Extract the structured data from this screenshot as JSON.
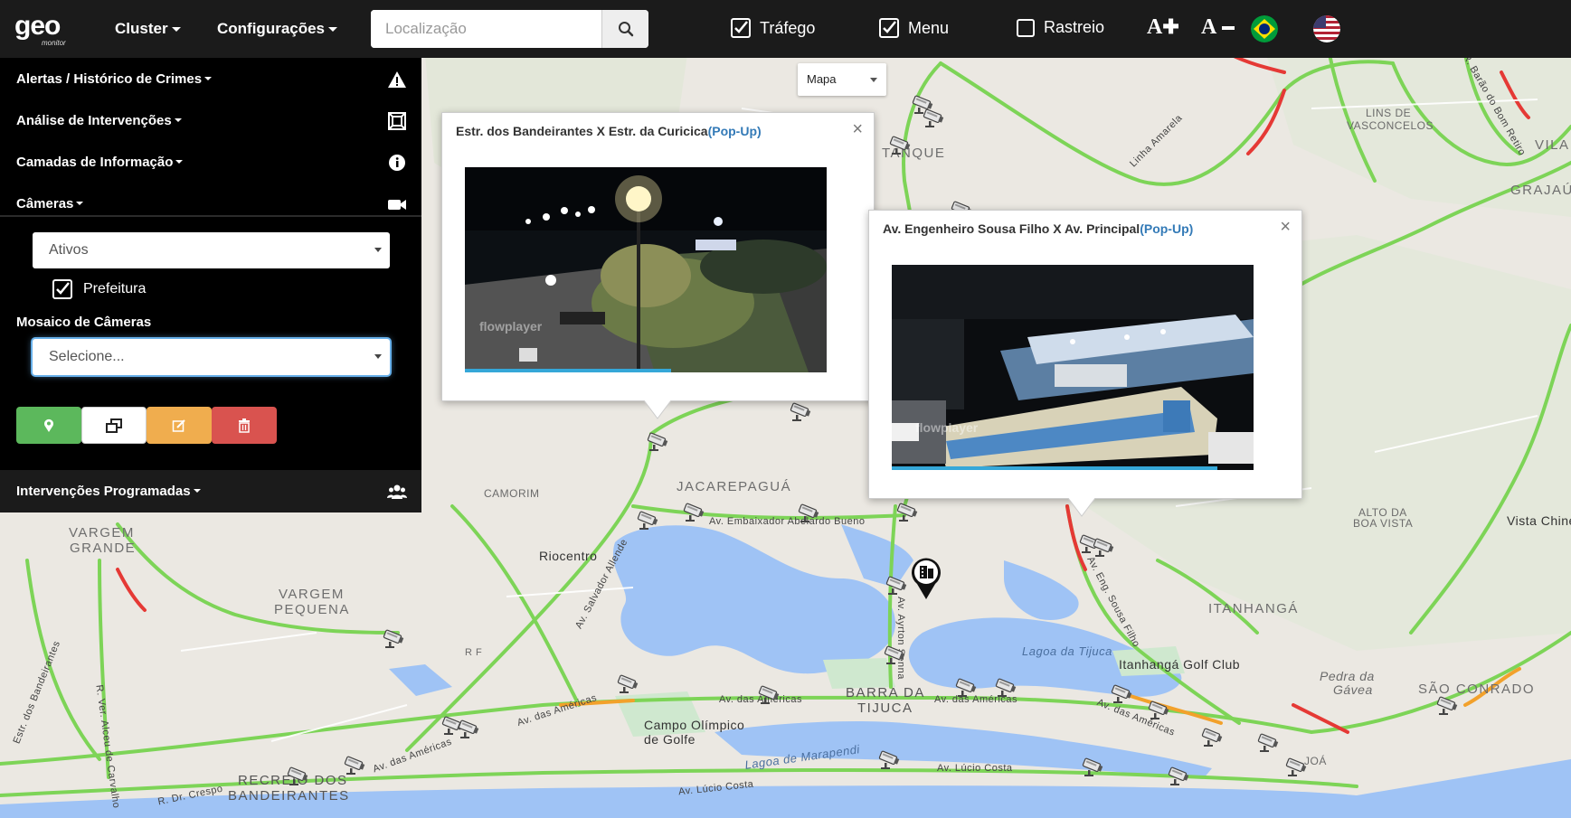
{
  "navbar": {
    "logo_text": "geo",
    "logo_subtext": "monitor",
    "menus": [
      "Cluster",
      "Configurações"
    ],
    "search_placeholder": "Localização",
    "checks": [
      {
        "label": "Tráfego",
        "checked": true
      },
      {
        "label": "Menu",
        "checked": true
      },
      {
        "label": "Rastreio",
        "checked": false
      }
    ],
    "font_increase": "A",
    "font_decrease": "A",
    "flags": [
      "brazil-flag-icon",
      "usa-flag-icon"
    ]
  },
  "sidebar": {
    "items": [
      {
        "label": "Alertas / Histórico de Crimes",
        "icon": "warning-icon"
      },
      {
        "label": "Análise de Intervenções",
        "icon": "frame-icon"
      },
      {
        "label": "Camadas de Informação",
        "icon": "info-icon"
      },
      {
        "label": "Câmeras",
        "icon": "video-camera-icon"
      }
    ],
    "status_select": "Ativos",
    "prefeitura_label": "Prefeitura",
    "prefeitura_checked": true,
    "mosaic_label": "Mosaico de Câmeras",
    "mosaic_select": "Selecione...",
    "buttons": [
      {
        "name": "locate",
        "color": "#5cb85c",
        "icon": "map-marker-icon"
      },
      {
        "name": "windows",
        "color": "#ffffff",
        "icon": "windows-icon"
      },
      {
        "name": "edit",
        "color": "#f0ad4e",
        "icon": "edit-icon"
      },
      {
        "name": "delete",
        "color": "#d9534f",
        "icon": "trash-icon"
      }
    ],
    "bottom_item": {
      "label": "Intervenções Programadas",
      "icon": "users-icon"
    }
  },
  "map": {
    "type_select": "Mapa",
    "labels": {
      "tanque": "TANQUE",
      "lins": "LINS DE",
      "vasconcelos": "VASCONCELOS",
      "vila": "VILA",
      "grajau": "GRAJAÚ",
      "linha_amarela": "Linha Amarela",
      "r_barao": "R. Barão do Bom Retiro",
      "camorim": "CAMORIM",
      "jacarepagua": "JACAREPAGUÁ",
      "vargem_grande_1": "VARGEM",
      "vargem_grande_2": "GRANDE",
      "riocentro": "Riocentro",
      "vargem_pequena_1": "VARGEM",
      "vargem_pequena_2": "PEQUENA",
      "av_embaixador": "Av. Embaixador Abelardo Bueno",
      "av_salvador": "Av. Salvador Allende",
      "alto_boa_vista_1": "ALTO DA",
      "alto_boa_vista_2": "BOA VISTA",
      "vista_chinesa": "Vista Chinesa",
      "itanhanga": "ITANHANGÁ",
      "lagoa_tijuca": "Lagoa da Tijuca",
      "itanhanga_golf": "Itanhangá Golf Club",
      "pedra_gavea_1": "Pedra da",
      "pedra_gavea_2": "Gávea",
      "sao_conrado": "SÃO CONRADO",
      "barra_1": "BARRA DA",
      "barra_2": "TIJUCA",
      "av_americas": "Av. das Américas",
      "campo_olimpico_1": "Campo Olímpico",
      "campo_olimpico_2": "de Golfe",
      "lagoa_marapendi": "Lagoa de Marapendi",
      "av_lucio_costa": "Av. Lúcio Costa",
      "recreio_1": "RECREIO DOS",
      "recreio_2": "BANDEIRANTES",
      "r_dr_crespo": "R. Dr. Crespo",
      "av_ayrton": "Av. Ayrton Senna",
      "av_eng_sousa": "Av. Eng. Sousa Filho",
      "joa": "JOÁ",
      "r_f": "R F",
      "estr_bandeirantes": "Estr. dos Bandeirantes",
      "r_ver_alceu": "R. Ver. Alceu de Carvalho"
    }
  },
  "popups": [
    {
      "title": "Estr. dos Bandeirantes X Estr. da Curicica",
      "link": "(Pop-Up)",
      "watermark": "flowplayer",
      "progress": 0.57
    },
    {
      "title": "Av. Engenheiro Sousa Filho X Av. Principal",
      "link": "(Pop-Up)",
      "watermark": "flowplayer",
      "progress": 0.9
    }
  ]
}
